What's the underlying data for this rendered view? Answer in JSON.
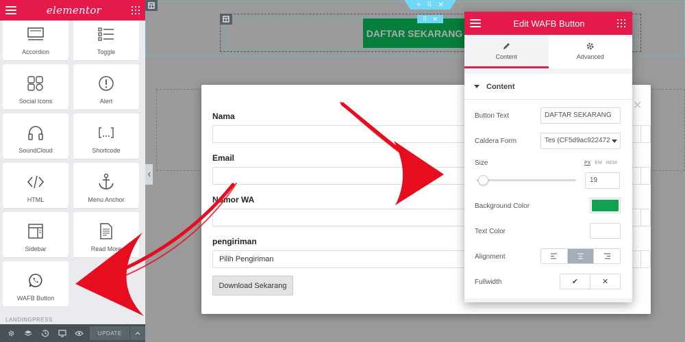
{
  "left_panel": {
    "logo": "elementor",
    "widgets": [
      {
        "label": "Accordion",
        "icon": "accordion-icon"
      },
      {
        "label": "Toggle",
        "icon": "toggle-icon"
      },
      {
        "label": "Social Icons",
        "icon": "social-icons-icon"
      },
      {
        "label": "Alert",
        "icon": "alert-icon"
      },
      {
        "label": "SoundCloud",
        "icon": "headphones-icon"
      },
      {
        "label": "Shortcode",
        "icon": "shortcode-icon"
      },
      {
        "label": "HTML",
        "icon": "code-icon"
      },
      {
        "label": "Menu Anchor",
        "icon": "anchor-icon"
      },
      {
        "label": "Sidebar",
        "icon": "sidebar-icon"
      },
      {
        "label": "Read More",
        "icon": "read-more-icon"
      },
      {
        "label": "WAFB Button",
        "icon": "whatsapp-icon"
      }
    ],
    "section_label": "LANDINGPRESS",
    "footer": {
      "update_label": "UPDATE"
    }
  },
  "canvas": {
    "button_text": "DAFTAR SEKARANG"
  },
  "form": {
    "fields": [
      {
        "label": "Nama",
        "value": ""
      },
      {
        "label": "Email",
        "value": ""
      },
      {
        "label": "Nomor WA",
        "value": ""
      },
      {
        "label": "pengiriman",
        "value": "Pilih Pengiriman"
      }
    ],
    "submit_label": "Download Sekarang",
    "close_symbol": "✕"
  },
  "edit_panel": {
    "title": "Edit WAFB Button",
    "tabs": [
      {
        "label": "Content",
        "icon": "pencil-icon",
        "active": true
      },
      {
        "label": "Advanced",
        "icon": "gear-icon",
        "active": false
      }
    ],
    "section_title": "Content",
    "button_text_label": "Button Text",
    "button_text_value": "DAFTAR SEKARANG",
    "caldera_label": "Caldera Form",
    "caldera_value": "Tes (CF5d9ac922472",
    "size_label": "Size",
    "size_units": [
      "PX",
      "EM",
      "REM"
    ],
    "size_value": "19",
    "bg_color_label": "Background Color",
    "bg_color": "#12a150",
    "text_color_label": "Text Color",
    "text_color": "#ffffff",
    "alignment_label": "Alignment",
    "alignment_active": "center",
    "fullwidth_label": "Fullwidth",
    "fullwidth_yes": "✔",
    "fullwidth_no": "✕"
  },
  "colors": {
    "brand": "#e6194b",
    "arrow": "#e60d1f",
    "button_green": "#057d3b",
    "handle_blue": "#71d7f7"
  }
}
